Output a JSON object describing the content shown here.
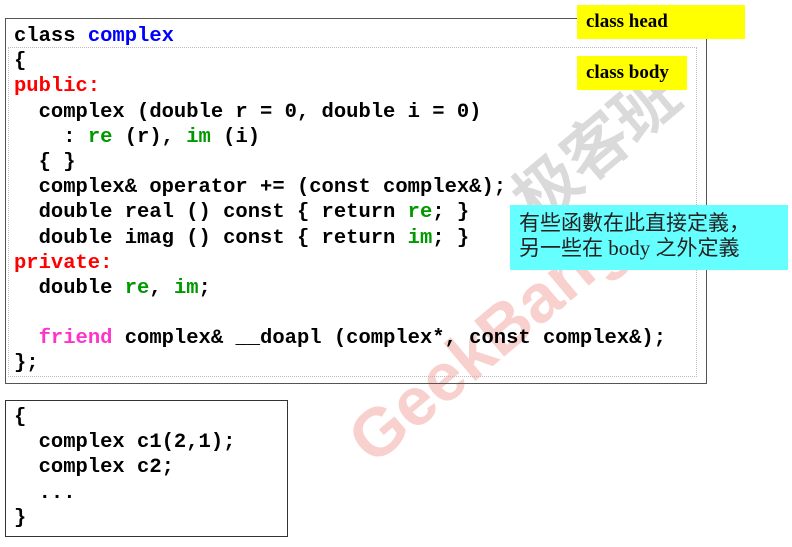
{
  "colors": {
    "keyword_type": "#0000ff",
    "access": "#ff0000",
    "member": "#009900",
    "friend": "#ff33cc",
    "label_bg": "#ffff00",
    "note_bg": "#66ffff"
  },
  "labels": {
    "class_head": "class head",
    "class_body": "class body"
  },
  "note": {
    "line1": "有些函數在此直接定義，",
    "line2": "另一些在 body 之外定義"
  },
  "watermark": {
    "latin": "GeekBang",
    "chinese": "极客班"
  },
  "class_code": [
    [
      {
        "t": "class "
      },
      {
        "t": "complex",
        "c": "keyword_type"
      }
    ],
    [
      {
        "t": "{"
      }
    ],
    [
      {
        "t": "public:",
        "c": "access"
      }
    ],
    [
      {
        "t": "  complex (double r = 0, double i = 0)"
      }
    ],
    [
      {
        "t": "    : "
      },
      {
        "t": "re",
        "c": "member"
      },
      {
        "t": " (r), "
      },
      {
        "t": "im",
        "c": "member"
      },
      {
        "t": " (i)"
      }
    ],
    [
      {
        "t": "  { }"
      }
    ],
    [
      {
        "t": "  complex& operator += (const complex&);"
      }
    ],
    [
      {
        "t": "  double real () const { return "
      },
      {
        "t": "re",
        "c": "member"
      },
      {
        "t": "; }"
      }
    ],
    [
      {
        "t": "  double imag () const { return "
      },
      {
        "t": "im",
        "c": "member"
      },
      {
        "t": "; }"
      }
    ],
    [
      {
        "t": "private:",
        "c": "access"
      }
    ],
    [
      {
        "t": "  double "
      },
      {
        "t": "re",
        "c": "member"
      },
      {
        "t": ", "
      },
      {
        "t": "im",
        "c": "member"
      },
      {
        "t": ";"
      }
    ],
    [
      {
        "t": " "
      }
    ],
    [
      {
        "t": "  "
      },
      {
        "t": "friend",
        "c": "friend"
      },
      {
        "t": " complex& __doapl (complex*, const complex&);"
      }
    ],
    [
      {
        "t": "};"
      }
    ]
  ],
  "main_code": [
    [
      {
        "t": "{"
      }
    ],
    [
      {
        "t": "  complex c1(2,1);"
      }
    ],
    [
      {
        "t": "  complex c2;"
      }
    ],
    [
      {
        "t": "  ..."
      }
    ],
    [
      {
        "t": "}"
      }
    ]
  ]
}
